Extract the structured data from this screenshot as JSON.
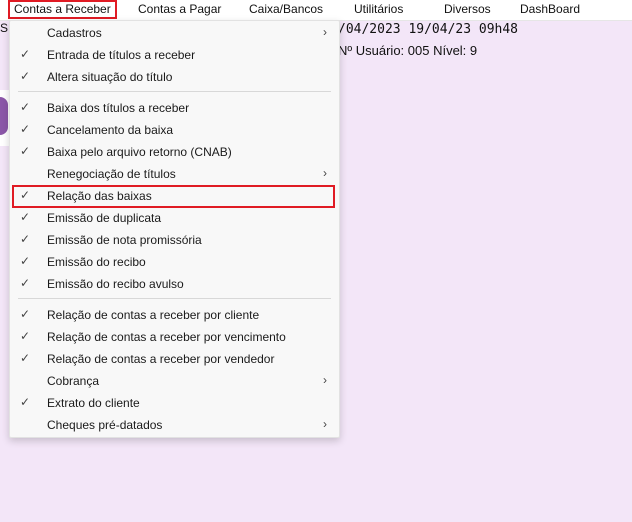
{
  "menubar": {
    "items": [
      {
        "label": "Contas a Receber"
      },
      {
        "label": "Contas a Pagar"
      },
      {
        "label": "Caixa/Bancos"
      },
      {
        "label": "Utilitários"
      },
      {
        "label": "Diversos"
      },
      {
        "label": "DashBoard"
      }
    ]
  },
  "status": {
    "left_fragment": "S",
    "date_line": "/04/2023  19/04/23 09h48",
    "user_line": "Nº Usuário: 005  Nível: 9"
  },
  "dropdown": {
    "items": [
      {
        "label": "Cadastros",
        "checked": false,
        "submenu": true
      },
      {
        "label": "Entrada de títulos a receber",
        "checked": true,
        "submenu": false
      },
      {
        "label": "Altera situação do título",
        "checked": true,
        "submenu": false
      },
      {
        "label": "Baixa dos títulos a receber",
        "checked": true,
        "submenu": false
      },
      {
        "label": "Cancelamento da baixa",
        "checked": true,
        "submenu": false
      },
      {
        "label": "Baixa pelo arquivo retorno (CNAB)",
        "checked": true,
        "submenu": false
      },
      {
        "label": "Renegociação de títulos",
        "checked": false,
        "submenu": true
      },
      {
        "label": "Relação das baixas",
        "checked": true,
        "submenu": false
      },
      {
        "label": "Emissão de duplicata",
        "checked": true,
        "submenu": false
      },
      {
        "label": "Emissão de nota promissória",
        "checked": true,
        "submenu": false
      },
      {
        "label": "Emissão do recibo",
        "checked": true,
        "submenu": false
      },
      {
        "label": "Emissão do recibo avulso",
        "checked": true,
        "submenu": false
      },
      {
        "label": "Relação de contas a receber por cliente",
        "checked": true,
        "submenu": false
      },
      {
        "label": "Relação de contas a receber por vencimento",
        "checked": true,
        "submenu": false
      },
      {
        "label": "Relação de contas a receber por vendedor",
        "checked": true,
        "submenu": false
      },
      {
        "label": "Cobrança",
        "checked": false,
        "submenu": true
      },
      {
        "label": "Extrato do cliente",
        "checked": true,
        "submenu": false
      },
      {
        "label": "Cheques pré-datados",
        "checked": false,
        "submenu": true
      }
    ],
    "check_glyph": "✓",
    "arrow_glyph": "›"
  },
  "colors": {
    "background": "#f3e6f8",
    "highlight": "#e01b24",
    "brand_purple": "#8b57a8"
  }
}
